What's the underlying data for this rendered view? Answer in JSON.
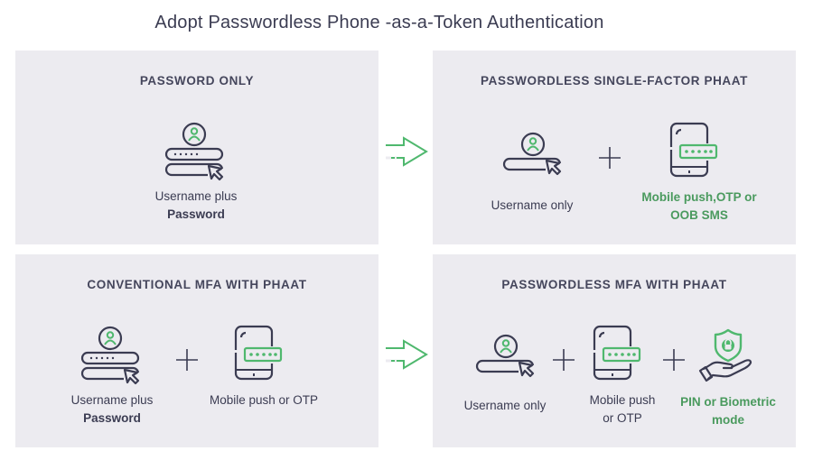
{
  "title": "Adopt Passwordless Phone -as-a-Token Authentication",
  "colors": {
    "panel_bg": "#ecebf0",
    "accent_green": "#4fb86e",
    "text_green": "#4a9a5e",
    "icon_dark": "#3b3c52"
  },
  "panels": [
    {
      "title": "PASSWORD ONLY",
      "items": [
        {
          "icon": "username-password-icon",
          "line1": "Username plus",
          "line2_bold": "Password"
        }
      ]
    },
    {
      "title": "PASSWORDLESS SINGLE-FACTOR PHAAT",
      "items": [
        {
          "icon": "username-icon",
          "line1": "Username only"
        },
        {
          "icon": "phone-otp-icon",
          "line1": "Mobile push,OTP or",
          "line2": "OOB SMS",
          "highlight": true
        }
      ]
    },
    {
      "title": "CONVENTIONAL MFA WITH PHAAT",
      "items": [
        {
          "icon": "username-password-icon",
          "line1": "Username plus",
          "line2_bold": "Password"
        },
        {
          "icon": "phone-otp-icon",
          "line1": "Mobile push or OTP"
        }
      ]
    },
    {
      "title": "PASSWORDLESS MFA WITH PHAAT",
      "items": [
        {
          "icon": "username-icon",
          "line1": "Username only"
        },
        {
          "icon": "phone-otp-icon",
          "line1": "Mobile push",
          "line2": "or OTP"
        },
        {
          "icon": "hand-shield-lock-icon",
          "line1": "PIN or Biometric",
          "line2": "mode",
          "highlight": true
        }
      ]
    }
  ],
  "connectors": [
    "arrow-right",
    "arrow-right"
  ],
  "operators": "+"
}
